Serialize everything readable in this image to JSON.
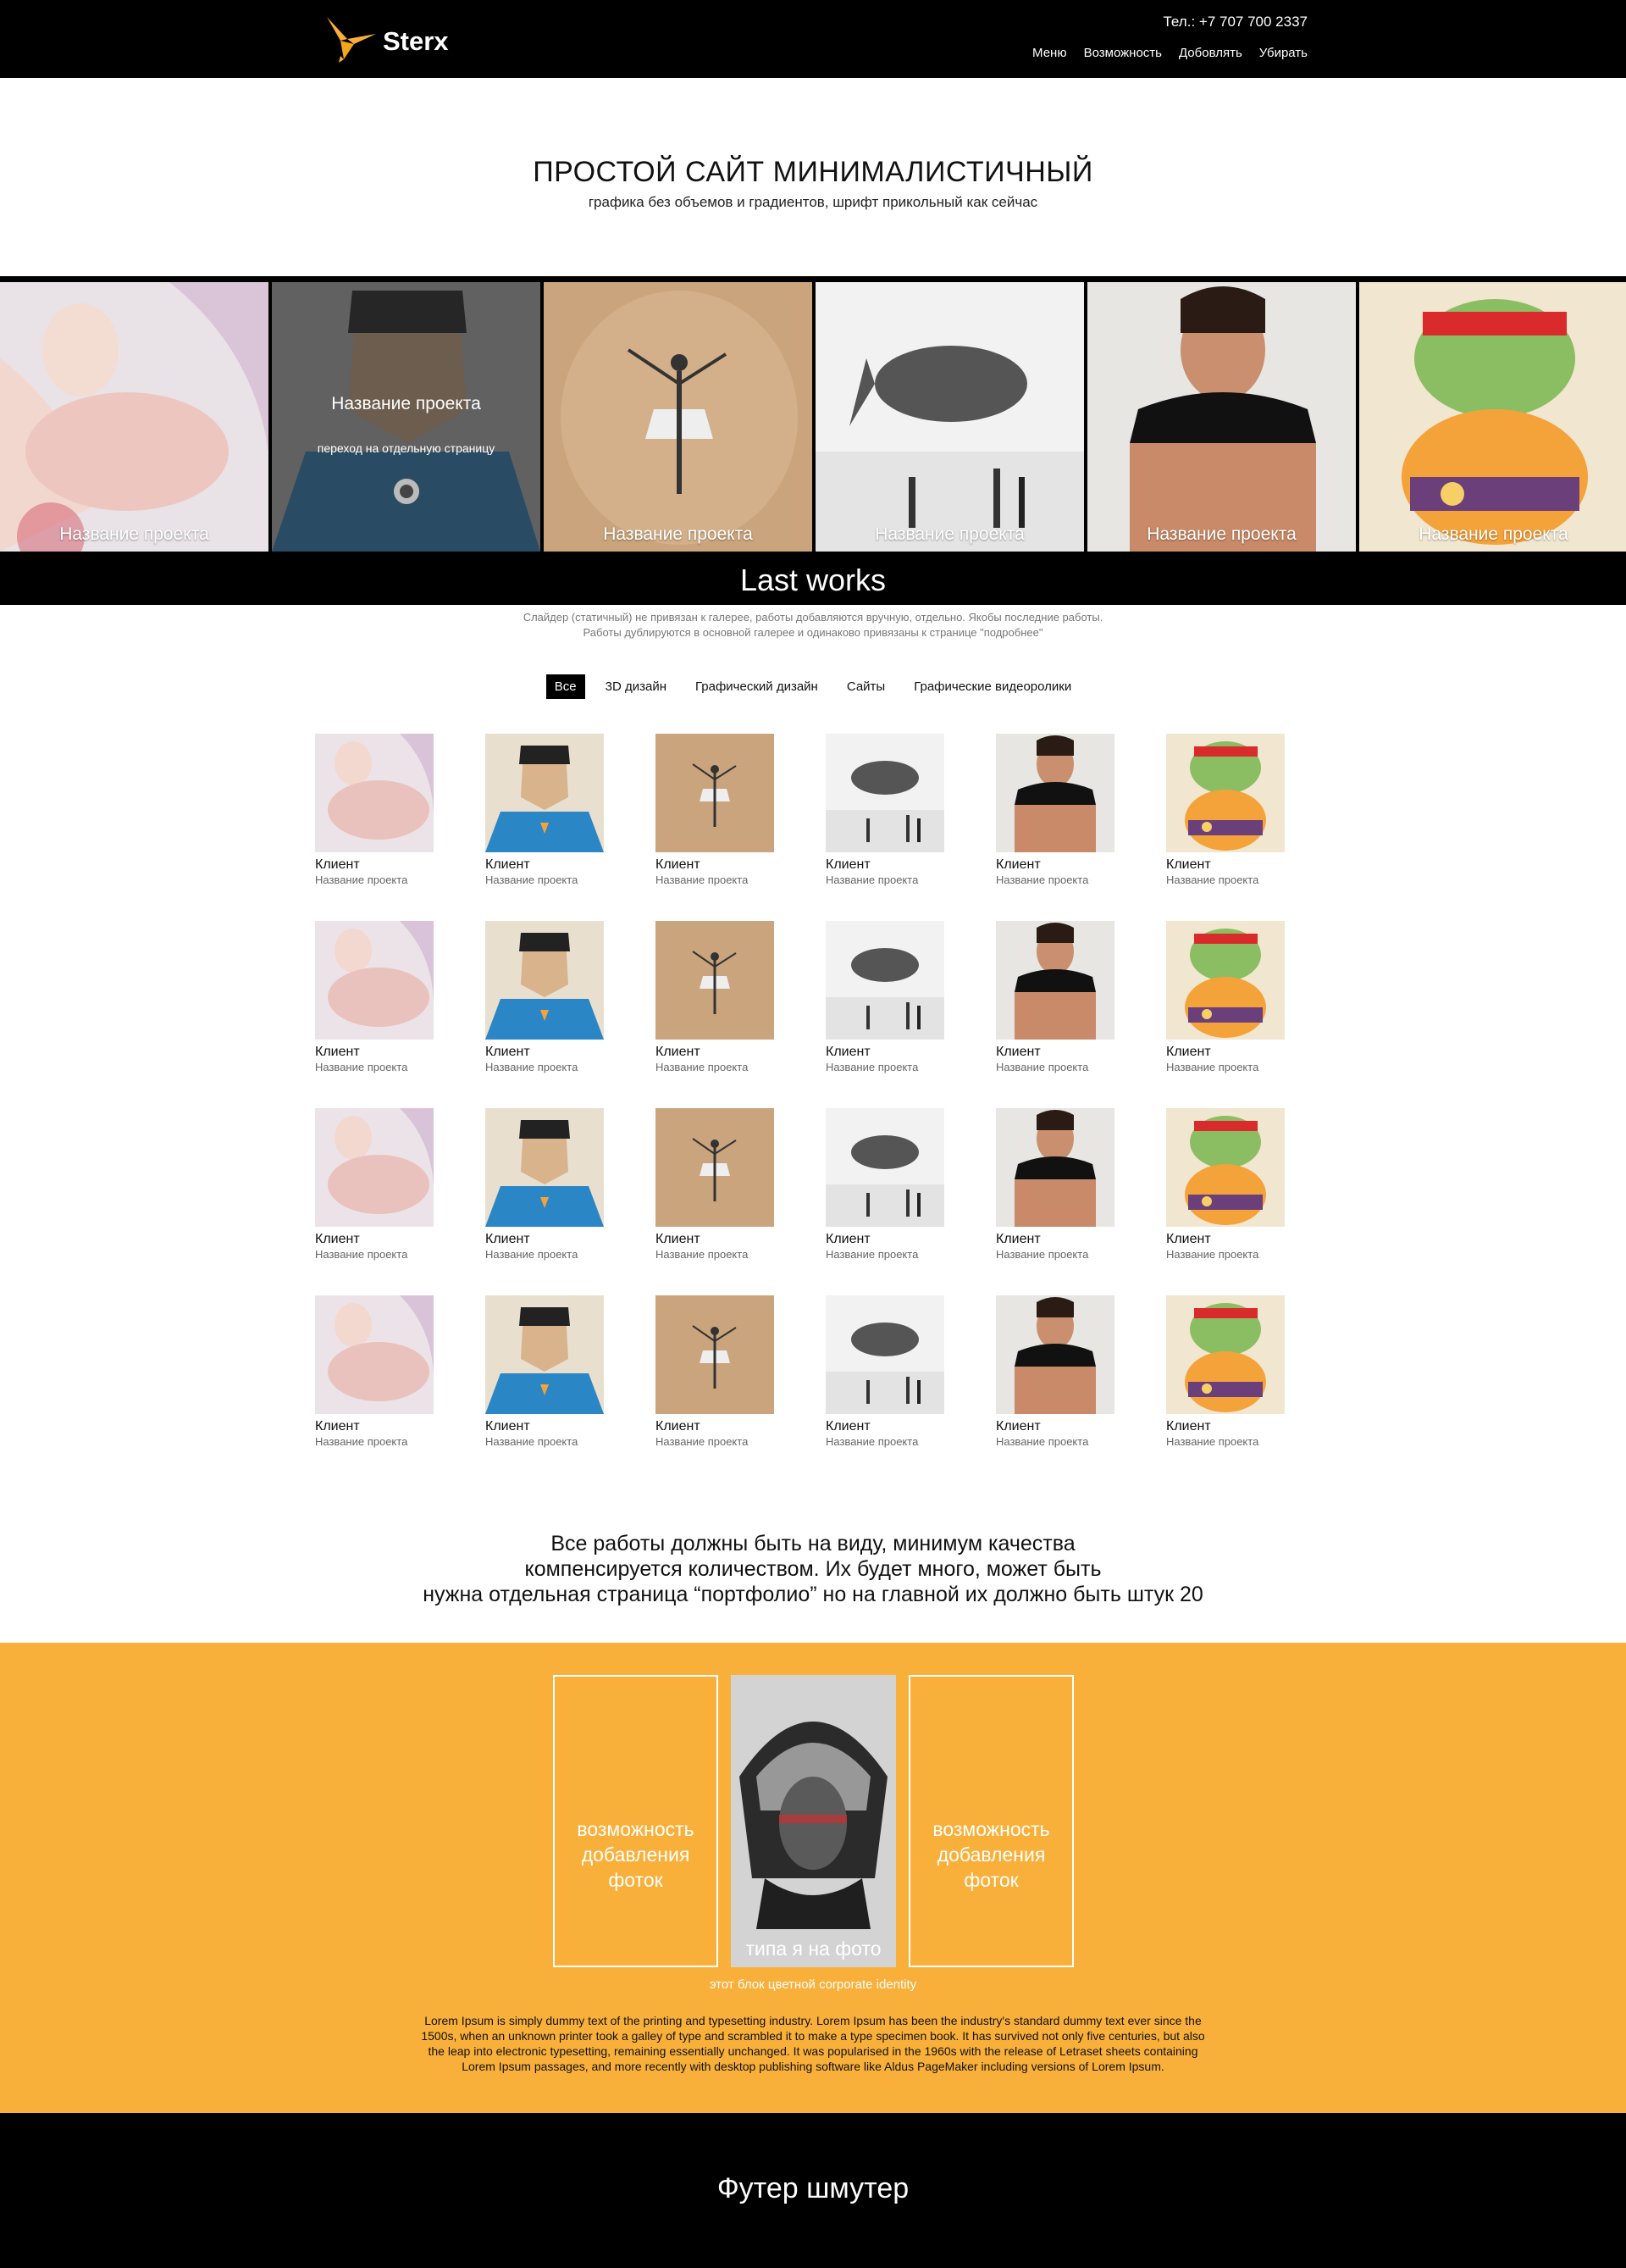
{
  "header": {
    "logo_text": "Sterx",
    "phone": "Тел.: +7 707  700 2337",
    "nav": [
      "Меню",
      "Возможность",
      "Добовлять",
      "Убирать"
    ]
  },
  "hero": {
    "title": "ПРОСТОЙ САЙТ МИНИМАЛИСТИЧНЫЙ",
    "subtitle": "графика без объемов и градиентов, шрифт прикольный как сейчас"
  },
  "slider": {
    "caption": "Название проекта",
    "overlay_title": "Название проекта",
    "overlay_link": "переход на отдельную страницу",
    "heading": "Last works"
  },
  "note": {
    "line1": "Слайдер (статичный) не привязан к галерее, работы добавляются вручную, отдельно. Якобы последние работы.",
    "line2": "Работы дублируются в основной галерее и одинаково привязаны к странице \"подробнее\""
  },
  "filters": [
    "Все",
    "3D дизайн",
    "Графический дизайн",
    "Сайты",
    "Графические видеоролики"
  ],
  "gallery": {
    "client": "Клиент",
    "project": "Название проекта"
  },
  "statement": {
    "line1": "Все работы должны быть на виду, минимум качества",
    "line2": "компенсируется количеством. Их будет много, может быть",
    "line3": "нужна отдельная страница “портфолио” но на главной их должно быть штук 20"
  },
  "orange": {
    "box_text_1": "возможность",
    "box_text_2": "добавления",
    "box_text_3": "фоток",
    "photo_caption": "типа я на фото",
    "corp_label": "этот блок цветной corporate identity",
    "lorem": "Lorem Ipsum is simply dummy text of the printing and typesetting industry. Lorem Ipsum has been the industry's standard dummy text ever since the 1500s, when an unknown printer took a galley of type and scrambled it to make a type specimen book. It has survived not only five centuries, but also the leap into electronic typesetting, remaining essentially unchanged. It was popularised in the 1960s with the release of Letraset sheets containing Lorem Ipsum passages, and more recently with desktop publishing software like Aldus PageMaker including versions of Lorem Ipsum."
  },
  "footer": {
    "text": "Футер шмутер"
  },
  "colors": {
    "accent": "#f9b03a",
    "header_bg": "#000000"
  }
}
